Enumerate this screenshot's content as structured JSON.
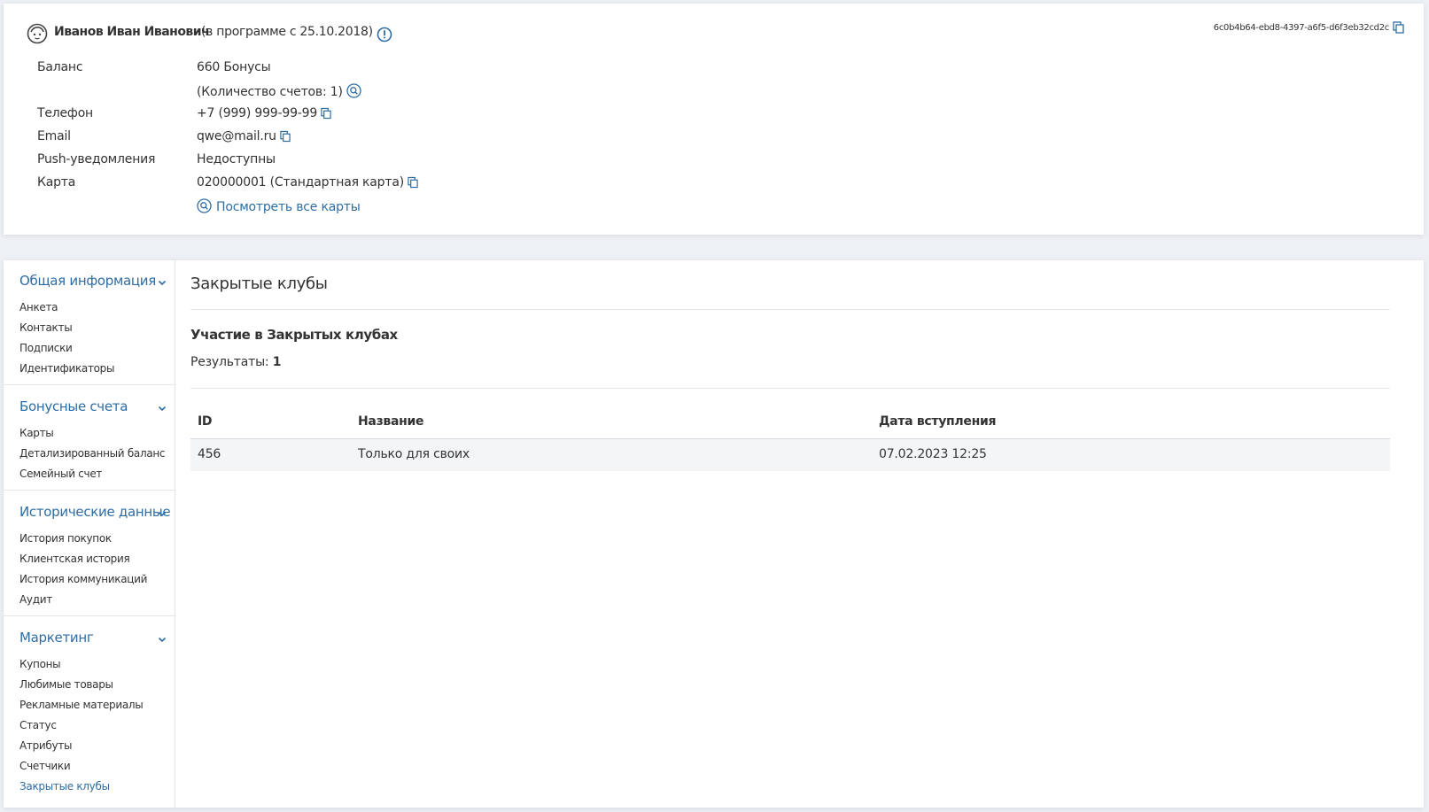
{
  "profile": {
    "name": "Иванов Иван Иванович",
    "program_since": "(в программе с 25.10.2018)",
    "uuid": "6c0b4b64-ebd8-4397-a6f5-d6f3eb32cd2c",
    "fields": {
      "balance_label": "Баланс",
      "balance_value": "660 Бонусы",
      "accounts_count": "(Количество счетов: 1)",
      "phone_label": "Телефон",
      "phone_value": "+7 (999) 999-99-99",
      "email_label": "Email",
      "email_value": "qwe@mail.ru",
      "push_label": "Push-уведомления",
      "push_value": "Недоступны",
      "card_label": "Карта",
      "card_value": "020000001 (Стандартная карта)",
      "view_all_cards": "Посмотреть все карты"
    }
  },
  "sidebar": {
    "sections": [
      {
        "title": "Общая информация",
        "items": [
          "Анкета",
          "Контакты",
          "Подписки",
          "Идентификаторы"
        ]
      },
      {
        "title": "Бонусные счета",
        "items": [
          "Карты",
          "Детализированный баланс",
          "Семейный счет"
        ]
      },
      {
        "title": "Исторические данные",
        "items": [
          "История покупок",
          "Клиентская история",
          "История коммуникаций",
          "Аудит"
        ]
      },
      {
        "title": "Маркетинг",
        "items": [
          "Купоны",
          "Любимые товары",
          "Рекламные материалы",
          "Статус",
          "Атрибуты",
          "Счетчики",
          "Закрытые клубы"
        ]
      }
    ],
    "active_item": "Закрытые клубы"
  },
  "content": {
    "title": "Закрытые клубы",
    "section_heading": "Участие в Закрытых клубах",
    "results_label": "Результаты:",
    "results_count": "1",
    "table": {
      "columns": [
        "ID",
        "Название",
        "Дата вступления"
      ],
      "rows": [
        [
          "456",
          "Только для своих",
          "07.02.2023 12:25"
        ]
      ]
    }
  },
  "colors": {
    "accent": "#2e6da4",
    "page_background": "#edf0f4",
    "card_background": "#ffffff",
    "row_background": "#f4f5f7"
  }
}
